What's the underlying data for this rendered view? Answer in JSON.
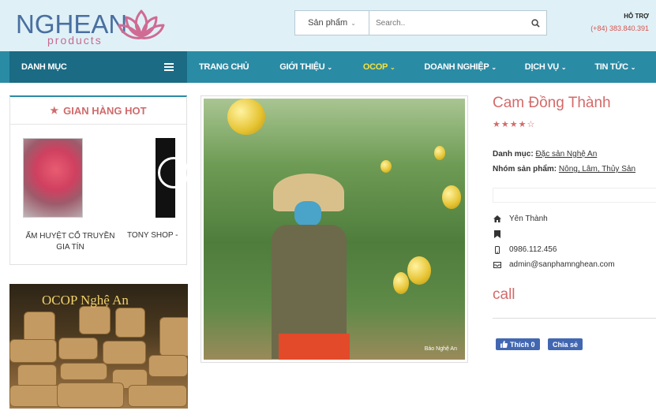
{
  "header": {
    "logo_main": "NGHEAN",
    "logo_sub": "products",
    "search": {
      "category": "Sản phẩm",
      "placeholder": "Search.."
    },
    "support_title": "HỖ TRỢ",
    "support_phone": "(+84) 383.840.391"
  },
  "nav": {
    "danhmuc_label": "DANH MỤC",
    "items": [
      {
        "label": "TRANG CHỦ",
        "caret": ""
      },
      {
        "label": "GIỚI THIỆU",
        "caret": "⌄"
      },
      {
        "label": "OCOP",
        "caret": "⌄"
      },
      {
        "label": "DOANH NGHIỆP",
        "caret": "⌄"
      },
      {
        "label": "DỊCH VỤ",
        "caret": "⌄"
      },
      {
        "label": "TIN TỨC",
        "caret": "⌄"
      }
    ],
    "active_item": "OCOP"
  },
  "sidebar": {
    "hot_title": "GIAN HÀNG HOT",
    "shops": [
      {
        "name": "ẤM HUYỆT CỔ TRUYỀN GIA TÍN"
      },
      {
        "name": "TONY SHOP -"
      }
    ],
    "banner_title": "OCOP Nghệ An"
  },
  "product": {
    "title": "Cam Đồng Thành",
    "rating": 4,
    "rating_max": 5,
    "category_label": "Danh mục:",
    "category_value": "Đặc sản Nghệ An",
    "group_label": "Nhóm sản phẩm:",
    "group_value": "Nông, Lâm, Thủy Sản",
    "location": "Yên Thành",
    "phone": "0986.112.456",
    "email": "admin@sanphamnghean.com",
    "call_label": "call",
    "like_label": "Thích 0",
    "share_label": "Chia sẻ",
    "image_watermark": "Báo Nghệ An"
  },
  "colors": {
    "header_bg": "#dff1f7",
    "nav_bg": "#2a8ba5",
    "danhmuc_bg": "#1b6b84",
    "accent_pink": "#d46a6a",
    "active_nav": "#f7e23b",
    "facebook_blue": "#4267b2"
  }
}
